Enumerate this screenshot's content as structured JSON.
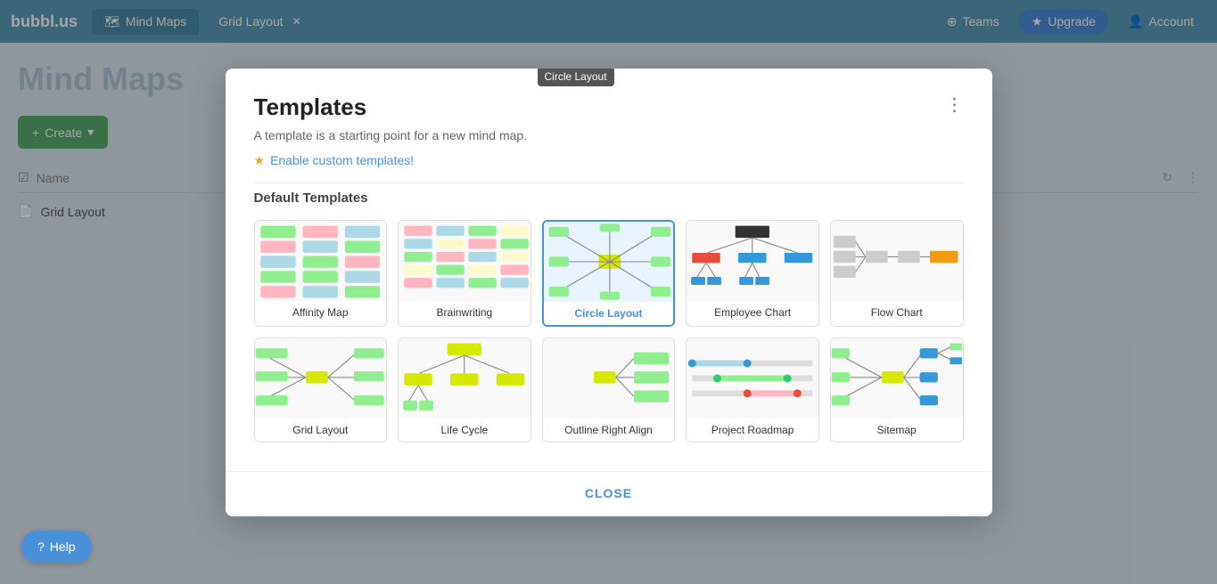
{
  "app": {
    "logo": "bubbl.us",
    "tabs": [
      {
        "label": "Mind Maps",
        "icon": "🗺",
        "active": true
      },
      {
        "label": "Grid Layout",
        "closable": true
      }
    ],
    "nav_buttons": [
      {
        "label": "Teams",
        "icon": "⊕"
      },
      {
        "label": "Upgrade",
        "icon": "★"
      },
      {
        "label": "Account",
        "icon": "👤"
      }
    ]
  },
  "background": {
    "page_title": "Mind Maps",
    "create_button": "+ Create",
    "table": {
      "columns": [
        "Name"
      ],
      "rows": [
        "Grid Layout"
      ]
    }
  },
  "modal": {
    "title": "Templates",
    "subtitle": "A template is a starting point for a new mind map.",
    "enable_link": "Enable custom templates!",
    "tooltip": "Circle Layout",
    "section_title": "Default Templates",
    "templates": [
      {
        "id": "affinity-map",
        "name": "Affinity Map",
        "selected": false
      },
      {
        "id": "brainwriting",
        "name": "Brainwriting",
        "selected": false
      },
      {
        "id": "circle-layout",
        "name": "Circle Layout",
        "selected": true
      },
      {
        "id": "employee-chart",
        "name": "Employee Chart",
        "selected": false
      },
      {
        "id": "flow-chart",
        "name": "Flow Chart",
        "selected": false
      },
      {
        "id": "grid-layout",
        "name": "Grid Layout",
        "selected": false
      },
      {
        "id": "life-cycle",
        "name": "Life Cycle",
        "selected": false
      },
      {
        "id": "outline-right-align",
        "name": "Outline Right Align",
        "selected": false
      },
      {
        "id": "project-roadmap",
        "name": "Project Roadmap",
        "selected": false
      },
      {
        "id": "sitemap",
        "name": "Sitemap",
        "selected": false
      }
    ],
    "close_button": "CLOSE"
  },
  "help": {
    "label": "Help",
    "icon": "?"
  }
}
